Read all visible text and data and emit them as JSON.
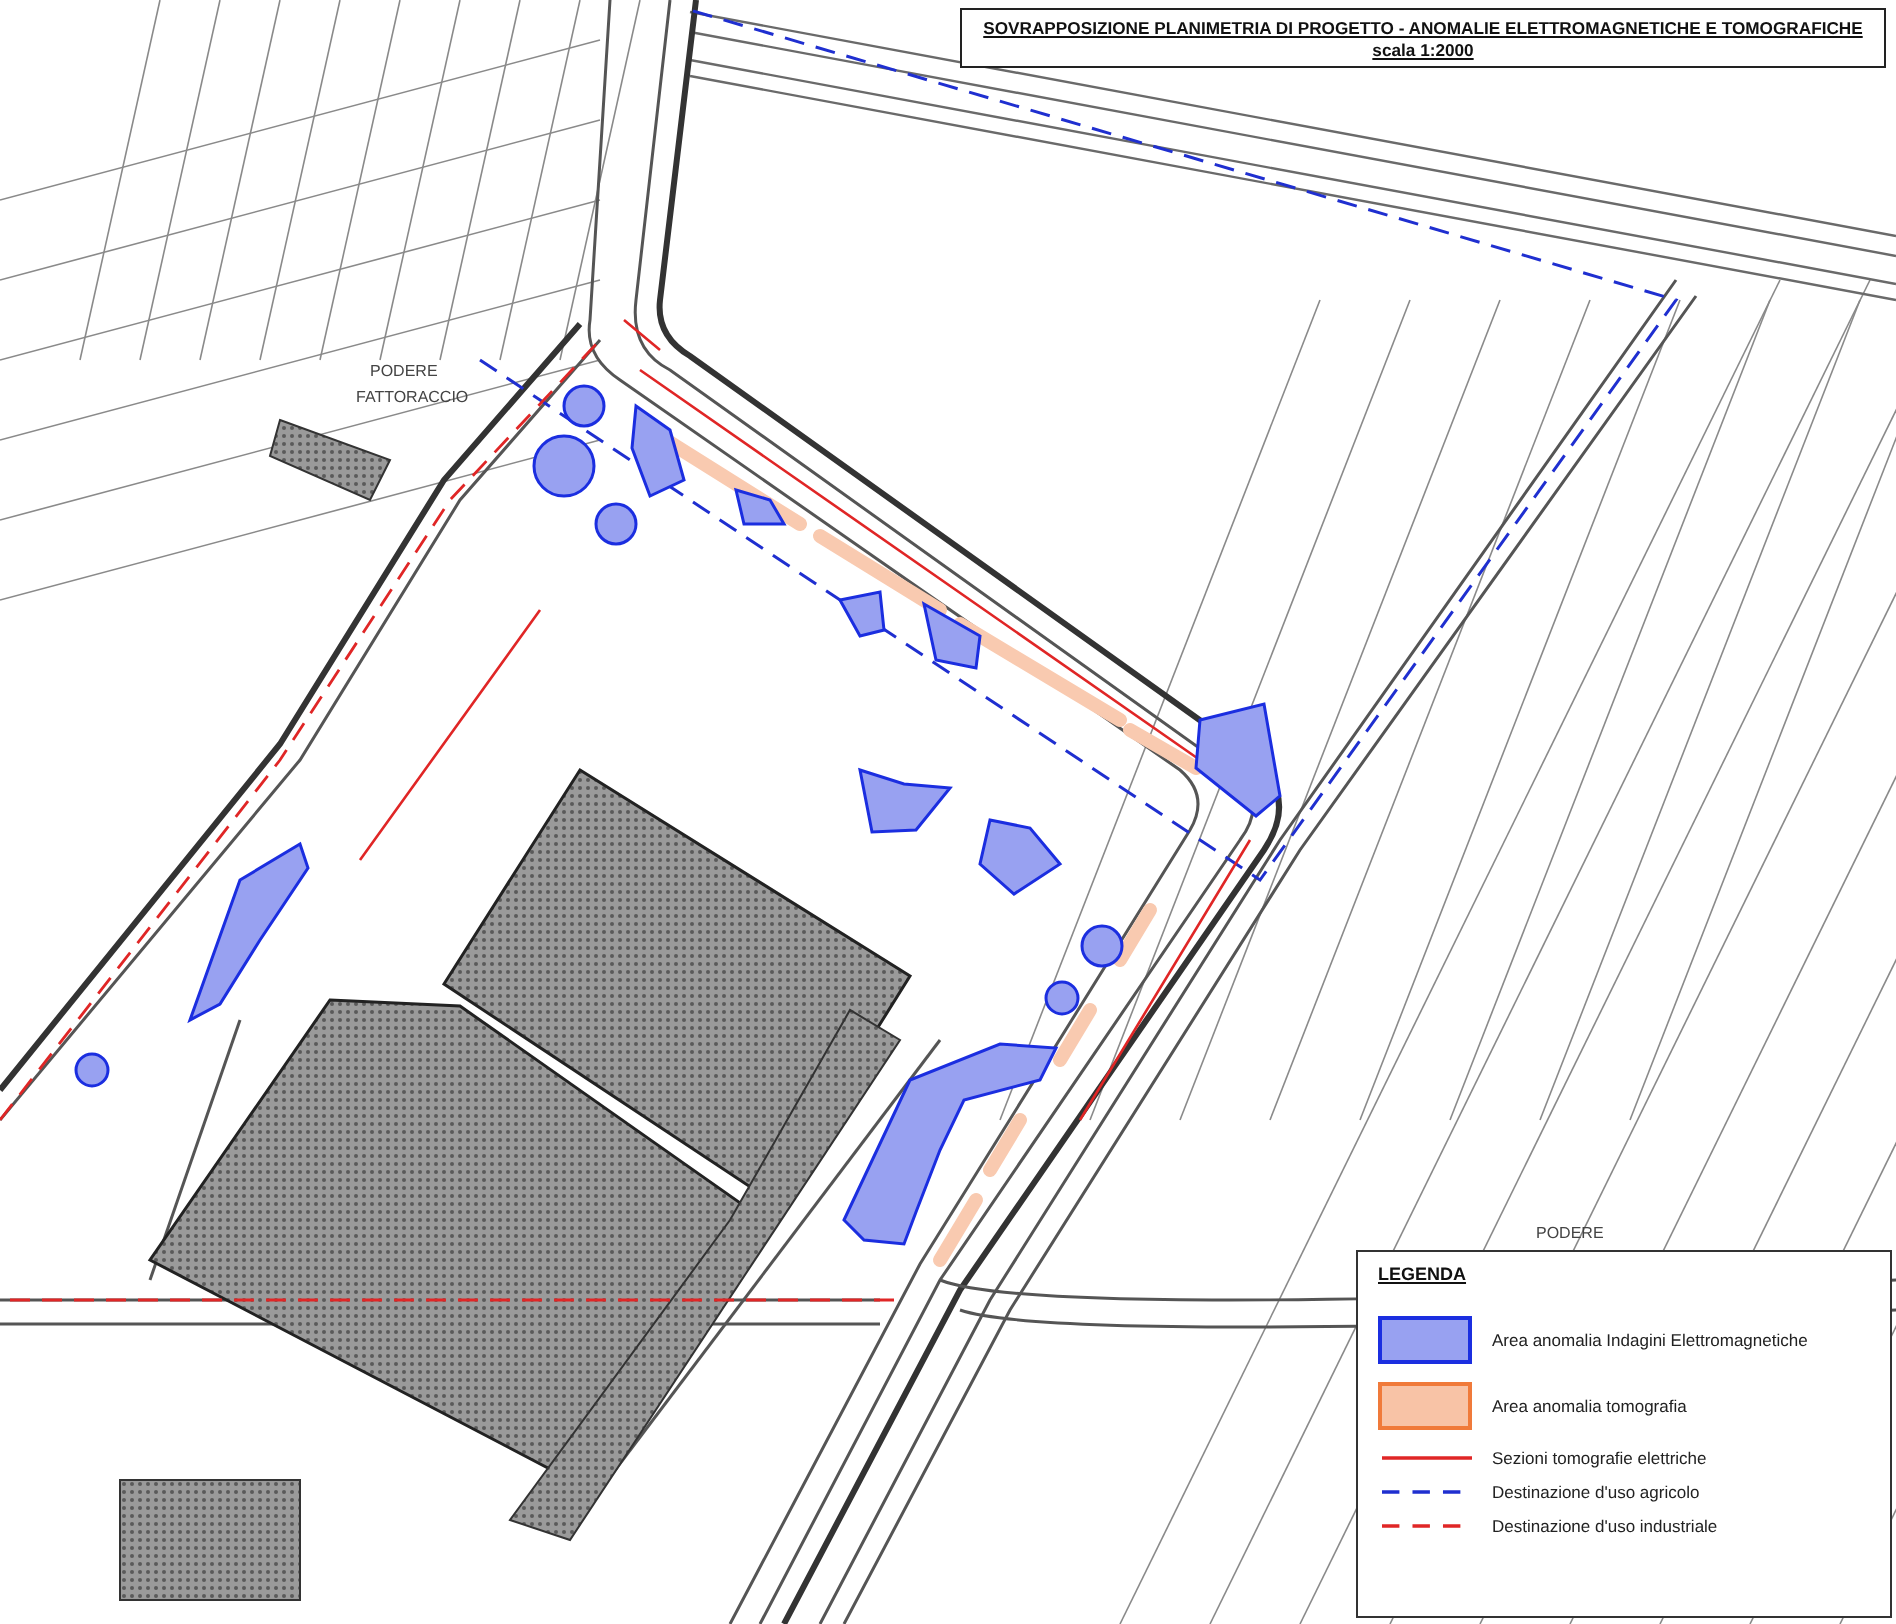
{
  "title": {
    "text": "SOVRAPPOSIZIONE PLANIMETRIA DI PROGETTO - ANOMALIE ELETTROMAGNETICHE E TOMOGRAFICHE",
    "scale": "scala 1:2000"
  },
  "map_labels": [
    {
      "text": "PODERE"
    },
    {
      "text": "FATTORACCIO"
    },
    {
      "text": "PODERE"
    }
  ],
  "legend": {
    "title": "LEGENDA",
    "items": [
      {
        "kind": "area",
        "label": "Area anomalia Indagini Elettromagnetiche",
        "color": "#1b2ee0"
      },
      {
        "kind": "area",
        "label": "Area anomalia tomografia",
        "color": "#f07a3a"
      },
      {
        "kind": "line",
        "label": "Sezioni tomografie elettriche",
        "color": "#e02626",
        "dashed": false
      },
      {
        "kind": "line",
        "label": "Destinazione d'uso agricolo",
        "color": "#1f2fd0",
        "dashed": true
      },
      {
        "kind": "line",
        "label": "Destinazione d'uso industriale",
        "color": "#e02626",
        "dashed": true
      }
    ]
  }
}
